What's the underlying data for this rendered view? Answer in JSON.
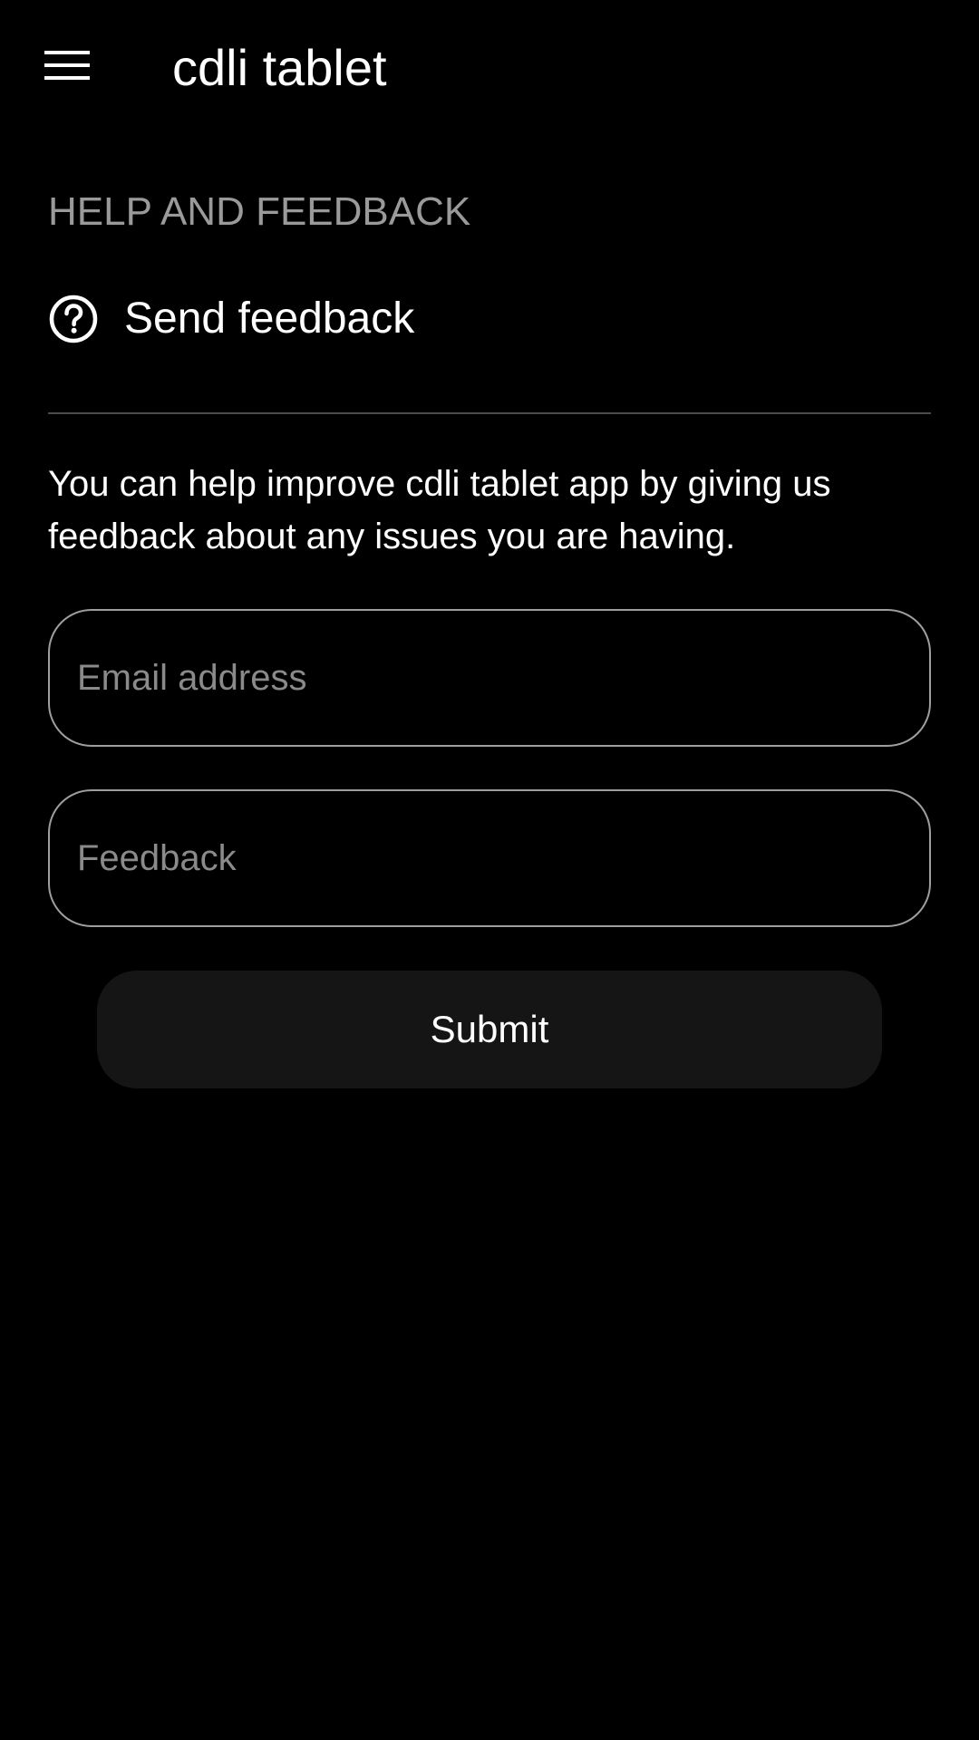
{
  "app_bar": {
    "menu_icon": "hamburger-menu-icon",
    "title": "cdli tablet"
  },
  "section": {
    "header": "HELP AND FEEDBACK",
    "item": {
      "icon": "help-circle-icon",
      "label": "Send feedback"
    }
  },
  "form": {
    "description": "You can help improve cdli tablet app by giving us feedback about any issues you are having.",
    "email": {
      "placeholder": "Email address",
      "value": ""
    },
    "feedback": {
      "placeholder": "Feedback",
      "value": ""
    },
    "submit_label": "Submit"
  },
  "colors": {
    "background": "#000000",
    "text": "#ffffff",
    "muted_text": "#9a9a9a",
    "field_border": "#9e9e9e",
    "button_bg": "#151515",
    "divider": "#4a4a4a"
  }
}
